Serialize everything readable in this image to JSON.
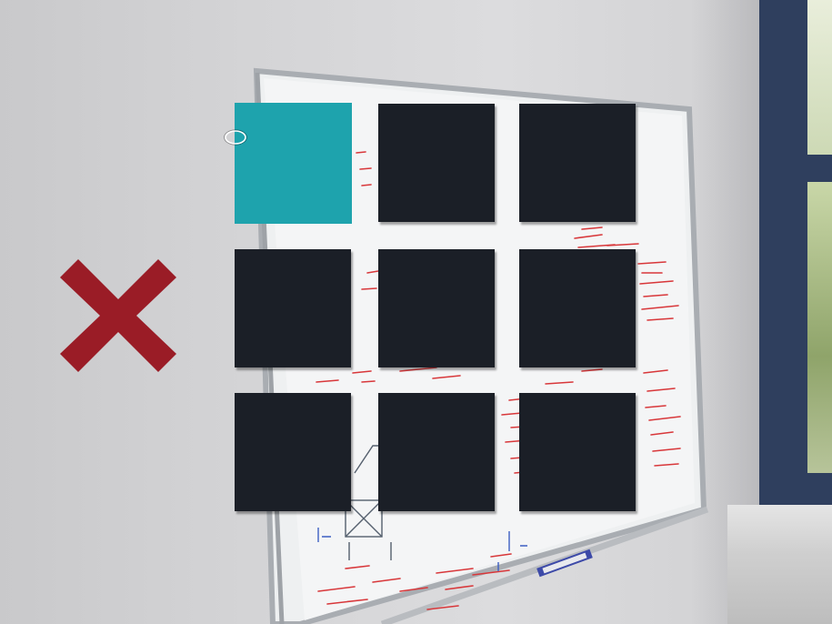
{
  "scene": {
    "description_free": true,
    "colors": {
      "tile_default": "#1b1f27",
      "tile_selected": "#1ea3ad",
      "close_mark": "#9a1c26",
      "marker_ink": "#d8373a"
    }
  },
  "grid": {
    "rows": 3,
    "columns": 3,
    "selected_index": 0,
    "tiles": [
      {
        "row": 1,
        "col": 1,
        "state": "selected"
      },
      {
        "row": 1,
        "col": 2,
        "state": "default"
      },
      {
        "row": 1,
        "col": 3,
        "state": "default"
      },
      {
        "row": 2,
        "col": 1,
        "state": "default"
      },
      {
        "row": 2,
        "col": 2,
        "state": "default"
      },
      {
        "row": 2,
        "col": 3,
        "state": "default"
      },
      {
        "row": 3,
        "col": 1,
        "state": "default"
      },
      {
        "row": 3,
        "col": 2,
        "state": "default"
      },
      {
        "row": 3,
        "col": 3,
        "state": "default"
      }
    ]
  },
  "icons": {
    "close": "close-x-icon",
    "gaze_cursor": "gaze-cursor-icon"
  }
}
